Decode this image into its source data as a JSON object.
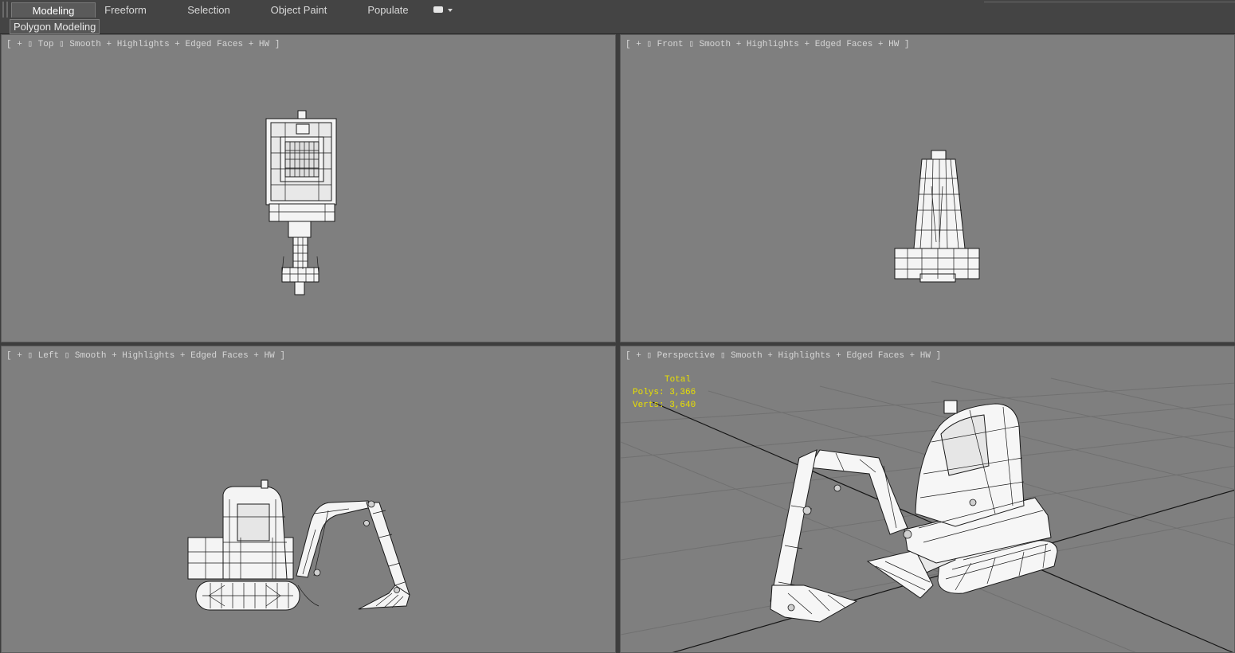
{
  "ribbon": {
    "tabs": [
      {
        "label": "Modeling",
        "active": true
      },
      {
        "label": "Freeform",
        "active": false
      },
      {
        "label": "Selection",
        "active": false
      },
      {
        "label": "Object Paint",
        "active": false
      },
      {
        "label": "Populate",
        "active": false
      }
    ],
    "dropdown_icon": "ribbon-options-icon",
    "panel_label": "Polygon Modeling"
  },
  "viewports": {
    "top": {
      "plus": "+",
      "name": "Top",
      "shading": "Smooth + Highlights + Edged Faces + HW"
    },
    "front": {
      "plus": "+",
      "name": "Front",
      "shading": "Smooth + Highlights + Edged Faces + HW"
    },
    "left": {
      "plus": "+",
      "name": "Left",
      "shading": "Smooth + Highlights + Edged Faces + HW"
    },
    "perspective": {
      "plus": "+",
      "name": "Perspective",
      "shading": "Smooth + Highlights + Edged Faces + HW"
    }
  },
  "stats": {
    "title": "Total",
    "polys": "Polys: 3,366",
    "verts": "Verts: 3,640"
  },
  "colors": {
    "viewport_bg": "#7f7f7f",
    "stats_text": "#e9e000",
    "ribbon_bg": "#444444"
  }
}
